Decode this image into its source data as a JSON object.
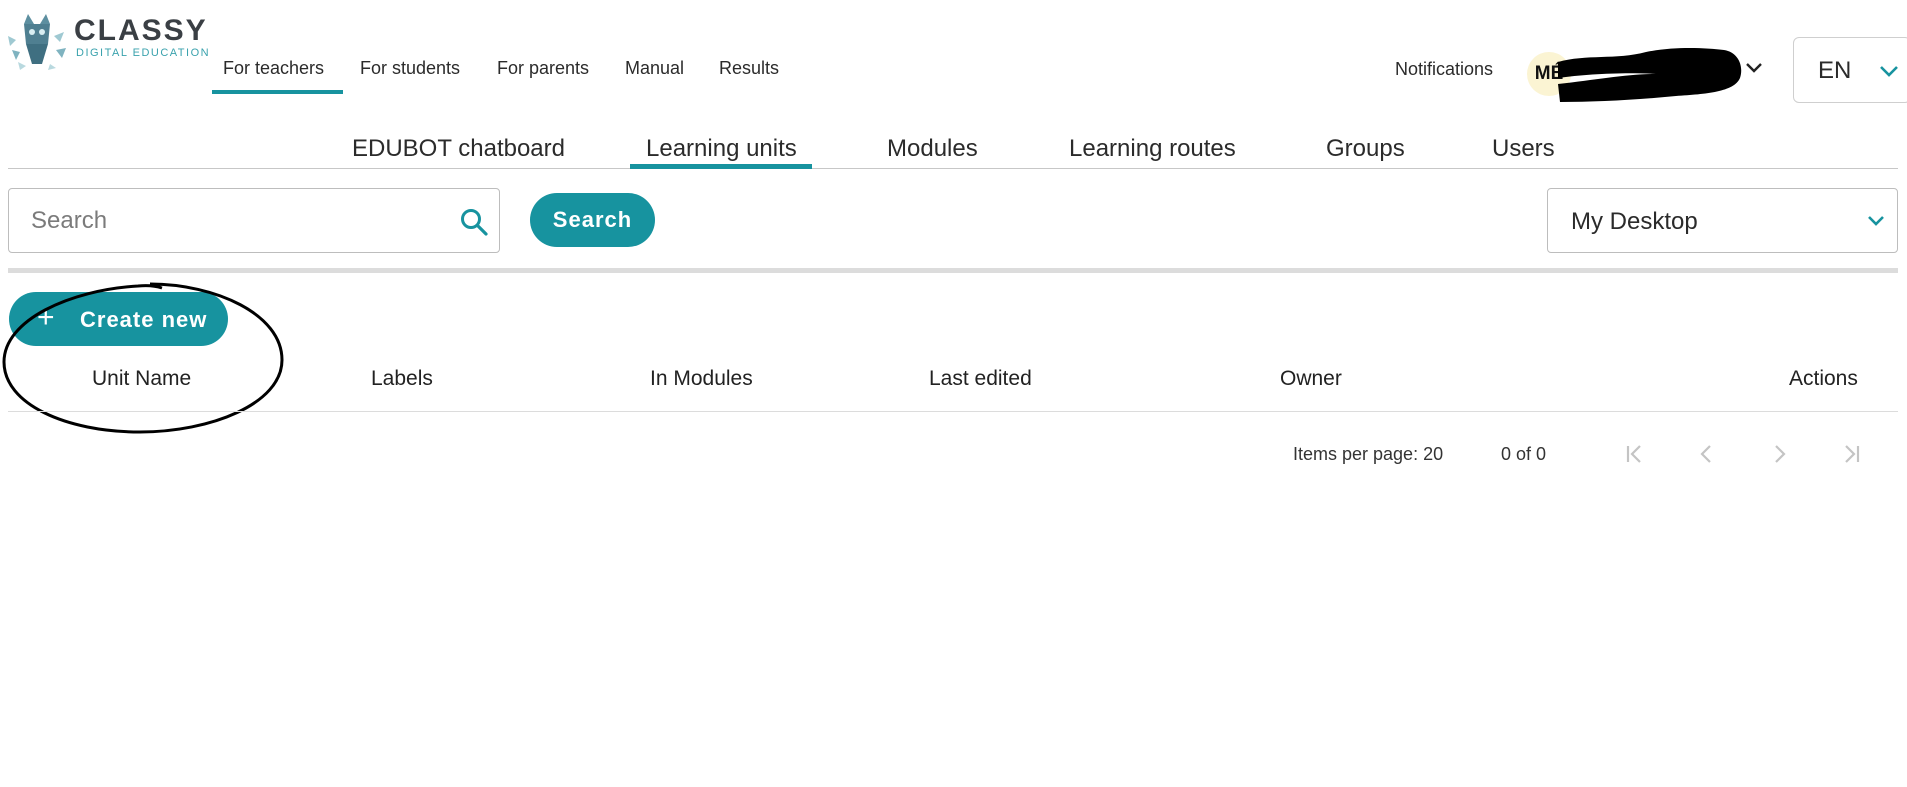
{
  "brand": {
    "name": "CLASSY",
    "tagline": "DIGITAL EDUCATION",
    "icon": "owl-logo-icon"
  },
  "top_nav": {
    "items": [
      {
        "label": "For teachers",
        "active": true
      },
      {
        "label": "For students",
        "active": false
      },
      {
        "label": "For parents",
        "active": false
      },
      {
        "label": "Manual",
        "active": false
      },
      {
        "label": "Results",
        "active": false
      }
    ]
  },
  "header_right": {
    "notifications_label": "Notifications",
    "avatar_initials": "MÉ",
    "user_menu_icon": "chevron-down-icon",
    "language": "EN"
  },
  "sub_nav": {
    "items": [
      {
        "label": "EDUBOT chatboard",
        "active": false
      },
      {
        "label": "Learning units",
        "active": true
      },
      {
        "label": "Modules",
        "active": false
      },
      {
        "label": "Learning routes",
        "active": false
      },
      {
        "label": "Groups",
        "active": false
      },
      {
        "label": "Users",
        "active": false
      }
    ]
  },
  "search": {
    "placeholder": "Search",
    "value": "",
    "button_label": "Search",
    "icon": "search-icon"
  },
  "scope_select": {
    "selected": "My Desktop"
  },
  "create_button": {
    "icon": "+",
    "label": "Create new"
  },
  "table": {
    "columns": [
      "Unit Name",
      "Labels",
      "In Modules",
      "Last edited",
      "Owner",
      "Actions"
    ],
    "rows": []
  },
  "paginator": {
    "items_per_page": "Items per page: 20",
    "range": "0 of 0"
  },
  "colors": {
    "accent": "#17939f",
    "text": "#222222",
    "avatar_bg": "#fbf4d3"
  }
}
